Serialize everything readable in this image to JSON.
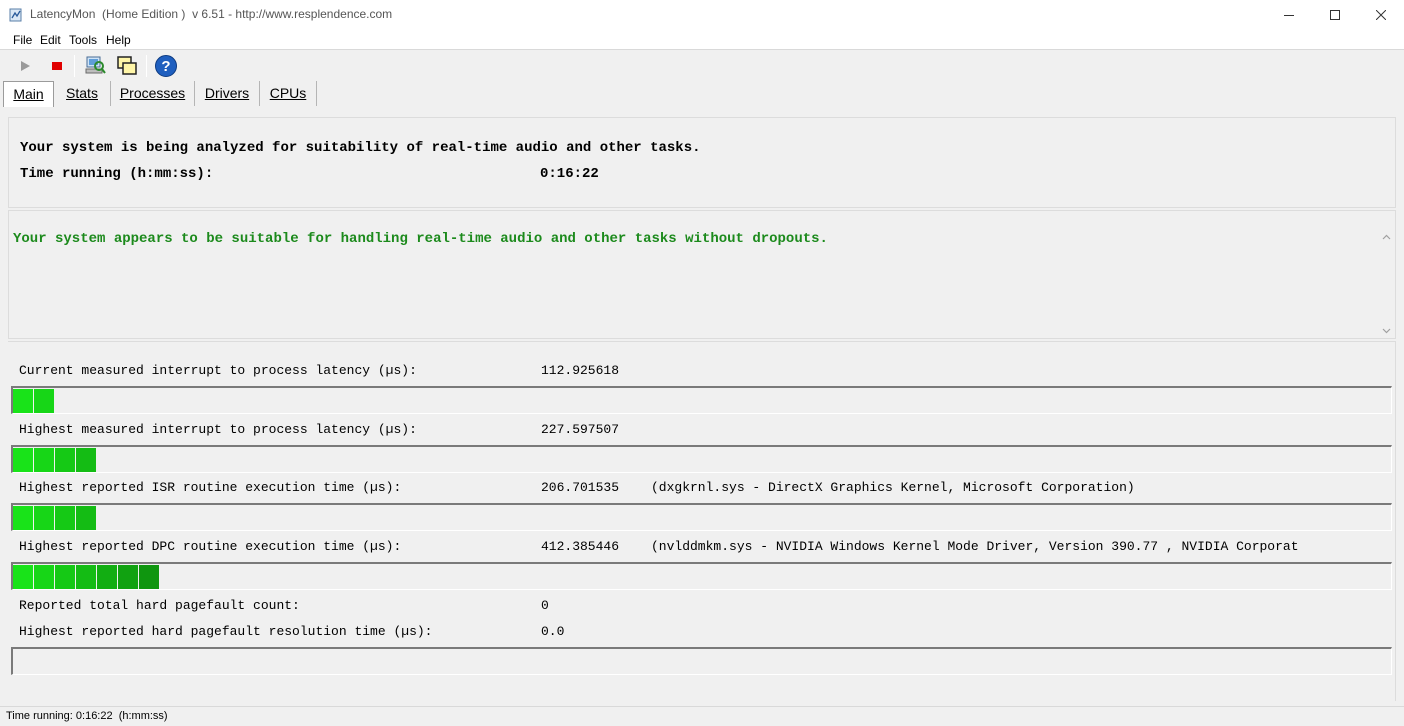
{
  "window": {
    "title": "LatencyMon  (Home Edition )  v 6.51 - http://www.resplendence.com"
  },
  "menu": [
    {
      "label": "File"
    },
    {
      "label": "Edit"
    },
    {
      "label": "Tools"
    },
    {
      "label": "Help"
    }
  ],
  "toolbar": {
    "icons": [
      "play-icon",
      "stop-icon",
      "computer-search-icon",
      "windows-icon",
      "help-icon"
    ],
    "accent_stop": "#e00000",
    "accent_help": "#1f5fbf"
  },
  "tabs": [
    {
      "label": "Main",
      "active": true
    },
    {
      "label": "Stats"
    },
    {
      "label": "Processes"
    },
    {
      "label": "Drivers"
    },
    {
      "label": "CPUs"
    }
  ],
  "header": {
    "analysis_text": "Your system is being analyzed for suitability of real-time audio and other tasks.",
    "time_label": "Time running (h:mm:ss):",
    "time_value": "0:16:22"
  },
  "verdict": {
    "text": "Your system appears to be suitable for handling real-time audio and other tasks without dropouts.",
    "color": "#1c8a1c"
  },
  "measurements": [
    {
      "label": "Current measured interrupt to process latency (µs):",
      "value": "112.925618",
      "extra": "",
      "bar_segments": 2
    },
    {
      "label": "Highest measured interrupt to process latency (µs):",
      "value": "227.597507",
      "extra": "",
      "bar_segments": 4
    },
    {
      "label": "Highest reported ISR routine execution time (µs):",
      "value": "206.701535",
      "extra": "(dxgkrnl.sys - DirectX Graphics Kernel, Microsoft Corporation)",
      "bar_segments": 4
    },
    {
      "label": "Highest reported DPC routine execution time (µs):",
      "value": "412.385446",
      "extra": "(nvlddmkm.sys - NVIDIA Windows Kernel Mode Driver, Version 390.77 , NVIDIA Corporat",
      "bar_segments": 7
    }
  ],
  "pagefaults": {
    "count_label": "Reported total hard pagefault count:",
    "count_value": "0",
    "resolution_label": "Highest reported hard pagefault resolution time (µs):",
    "resolution_value": "0.0",
    "bar_segments": 0
  },
  "status": {
    "text": "Time running: 0:16:22  (h:mm:ss)"
  }
}
